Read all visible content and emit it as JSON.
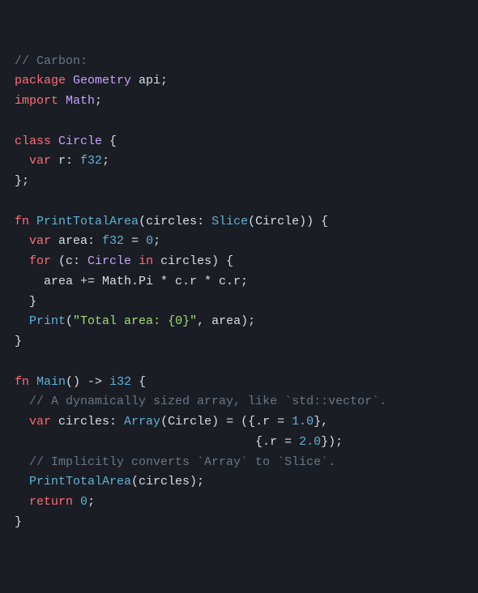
{
  "code": {
    "l01": {
      "c": "// Carbon:"
    },
    "l02": {
      "kw1": "package",
      "cls": "Geometry",
      "rest": " api;"
    },
    "l03": {
      "kw1": "import",
      "cls": "Math",
      "rest": ";"
    },
    "l04": {
      "blank": ""
    },
    "l05": {
      "kw1": "class",
      "cls": "Circle",
      "rest": " {"
    },
    "l06": {
      "ind": "  ",
      "kw1": "var",
      "name": " r: ",
      "typ": "f32",
      "rest": ";"
    },
    "l07": {
      "rest": "};"
    },
    "l08": {
      "blank": ""
    },
    "l09": {
      "kw1": "fn",
      "fn": "PrintTotalArea",
      "p1": "(circles: ",
      "fn2": "Slice",
      "p2": "(Circle)) {"
    },
    "l10": {
      "ind": "  ",
      "kw1": "var",
      "name": " area: ",
      "typ": "f32",
      "eq": " = ",
      "num": "0",
      "rest": ";"
    },
    "l11": {
      "ind": "  ",
      "kw1": "for",
      "p1": " (c: ",
      "cls": "Circle",
      "kw2": " in",
      "p2": " circles) {"
    },
    "l12": {
      "ind": "    ",
      "rest": "area += Math.Pi * c.r * c.r;"
    },
    "l13": {
      "ind": "  ",
      "rest": "}"
    },
    "l14": {
      "ind": "  ",
      "fn": "Print",
      "p1": "(",
      "str": "\"Total area: {0}\"",
      "p2": ", area);"
    },
    "l15": {
      "rest": "}"
    },
    "l16": {
      "blank": ""
    },
    "l17": {
      "kw1": "fn",
      "fn": "Main",
      "p1": "() -> ",
      "typ": "i32",
      "p2": " {"
    },
    "l18": {
      "ind": "  ",
      "c": "// A dynamically sized array, like `std::vector`."
    },
    "l19": {
      "ind": "  ",
      "kw1": "var",
      "name": " circles: ",
      "fn": "Array",
      "p1": "(Circle) = ({.r = ",
      "num": "1.0",
      "p2": "},"
    },
    "l20": {
      "ind": "                                 ",
      "p1": "{.r = ",
      "num": "2.0",
      "p2": "});"
    },
    "l21": {
      "ind": "  ",
      "c": "// Implicitly converts `Array` to `Slice`."
    },
    "l22": {
      "ind": "  ",
      "fn": "PrintTotalArea",
      "p1": "(circles);"
    },
    "l23": {
      "ind": "  ",
      "kw1": "return",
      "sp": " ",
      "num": "0",
      "rest": ";"
    },
    "l24": {
      "rest": "}"
    }
  }
}
